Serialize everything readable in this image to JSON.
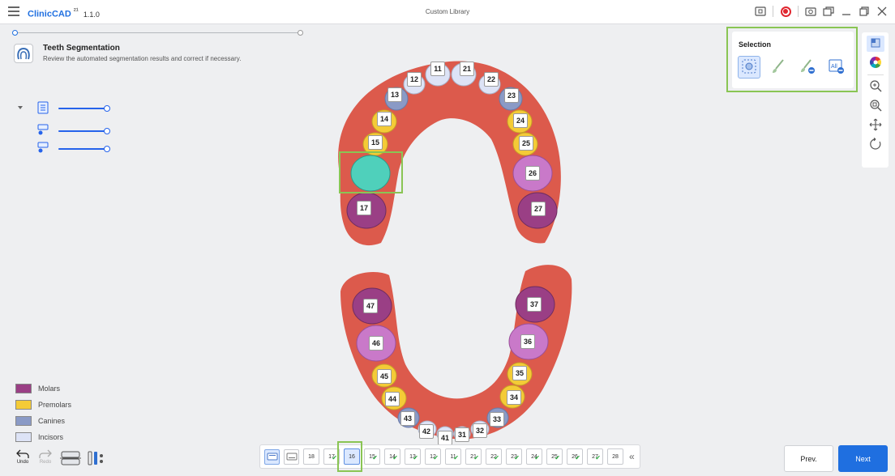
{
  "app": {
    "name": "ClinicCAD",
    "version_tag": "²¹",
    "version": "1.1.0",
    "document_title": "Custom Library"
  },
  "step": {
    "title": "Teeth Segmentation",
    "description": "Review the automated segmentation results and correct if necessary."
  },
  "selection_panel": {
    "title": "Selection",
    "tools": [
      {
        "name": "auto-select-icon",
        "active": true
      },
      {
        "name": "brush-icon",
        "active": false
      },
      {
        "name": "brush-remove-icon",
        "active": false
      },
      {
        "name": "all-remove-icon",
        "label": "All",
        "active": false
      }
    ]
  },
  "right_toolbar": {
    "tools": [
      "view-cube-icon",
      "color-wheel-icon",
      "zoom-in-icon",
      "zoom-fit-icon",
      "pan-icon",
      "rotate-icon"
    ]
  },
  "legend": [
    {
      "label": "Molars",
      "color": "#9a3f85"
    },
    {
      "label": "Premolars",
      "color": "#f4cb37"
    },
    {
      "label": "Canines",
      "color": "#8a9ac6"
    },
    {
      "label": "Incisors",
      "color": "#dde3f6"
    }
  ],
  "bottom_tools": {
    "undo": "Undo",
    "redo": "Redo"
  },
  "tooth_strip": {
    "teeth": [
      {
        "label": "18",
        "done": false,
        "selected": false
      },
      {
        "label": "17",
        "done": true,
        "selected": false
      },
      {
        "label": "16",
        "done": false,
        "selected": true
      },
      {
        "label": "15",
        "done": true,
        "selected": false
      },
      {
        "label": "14",
        "done": true,
        "selected": false
      },
      {
        "label": "13",
        "done": true,
        "selected": false
      },
      {
        "label": "12",
        "done": true,
        "selected": false
      },
      {
        "label": "11",
        "done": true,
        "selected": false
      },
      {
        "label": "21",
        "done": true,
        "selected": false
      },
      {
        "label": "22",
        "done": true,
        "selected": false
      },
      {
        "label": "23",
        "done": true,
        "selected": false
      },
      {
        "label": "24",
        "done": true,
        "selected": false
      },
      {
        "label": "25",
        "done": true,
        "selected": false
      },
      {
        "label": "26",
        "done": true,
        "selected": false
      },
      {
        "label": "27",
        "done": true,
        "selected": false
      },
      {
        "label": "28",
        "done": false,
        "selected": false
      }
    ],
    "collapse_glyph": "«"
  },
  "nav": {
    "prev": "Prev.",
    "next": "Next"
  },
  "upper_arch": {
    "labels": [
      "11",
      "21",
      "12",
      "22",
      "13",
      "23",
      "14",
      "24",
      "15",
      "25",
      "26",
      "17",
      "27"
    ]
  },
  "lower_arch": {
    "labels": [
      "47",
      "37",
      "46",
      "36",
      "45",
      "35",
      "44",
      "34",
      "43",
      "33",
      "42",
      "32",
      "41",
      "31"
    ]
  },
  "colors": {
    "gum": "#dc5a4c",
    "molar": "#9a3f85",
    "molar_light": "#c979c9",
    "premolar": "#f4cb37",
    "canine": "#8a9ac6",
    "incisor": "#dde3f6",
    "selected_tooth": "#4fd0bb",
    "highlight": "#8ac554",
    "accent": "#1f6fe0"
  }
}
